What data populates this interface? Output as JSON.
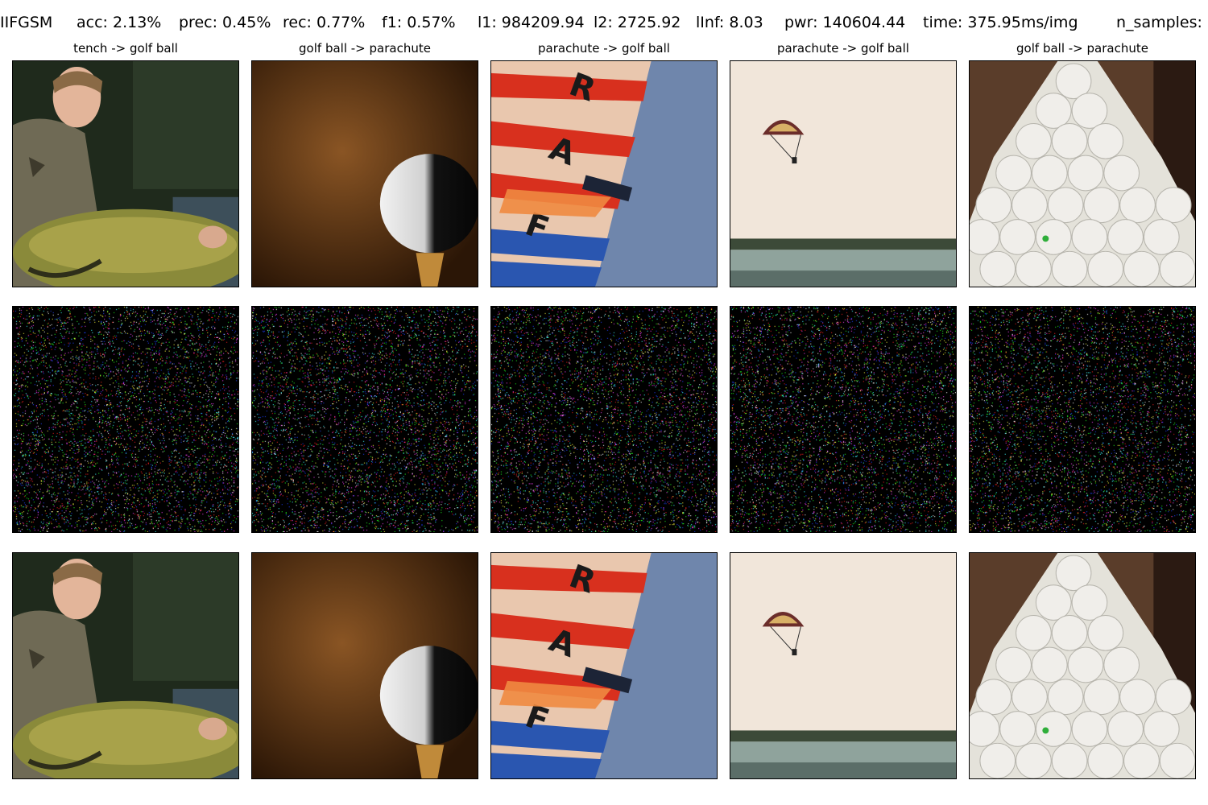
{
  "header": {
    "method": "IIFGSM",
    "acc": "acc: 2.13%",
    "prec": "prec: 0.45%",
    "rec": "rec: 0.77%",
    "f1": "f1: 0.57%",
    "l1": "l1: 984209.94",
    "l2": "l2: 2725.92",
    "linf": "lInf: 8.03",
    "pwr": "pwr: 140604.44",
    "time": "time: 375.95ms/img",
    "n_samples": "n_samples:"
  },
  "columns": [
    {
      "title": "tench -> golf ball",
      "source_class": "tench",
      "target_class": "golf ball"
    },
    {
      "title": "golf ball -> parachute",
      "source_class": "golf ball",
      "target_class": "parachute"
    },
    {
      "title": "parachute -> golf ball",
      "source_class": "parachute",
      "target_class": "golf ball"
    },
    {
      "title": "parachute -> golf ball",
      "source_class": "parachute",
      "target_class": "golf ball"
    },
    {
      "title": "golf ball -> parachute",
      "source_class": "golf ball",
      "target_class": "parachute"
    }
  ],
  "noise_colors": [
    "#ff2020",
    "#20ff20",
    "#2040ff",
    "#ffffff",
    "#ffff40",
    "#ff40ff",
    "#40ffff"
  ]
}
